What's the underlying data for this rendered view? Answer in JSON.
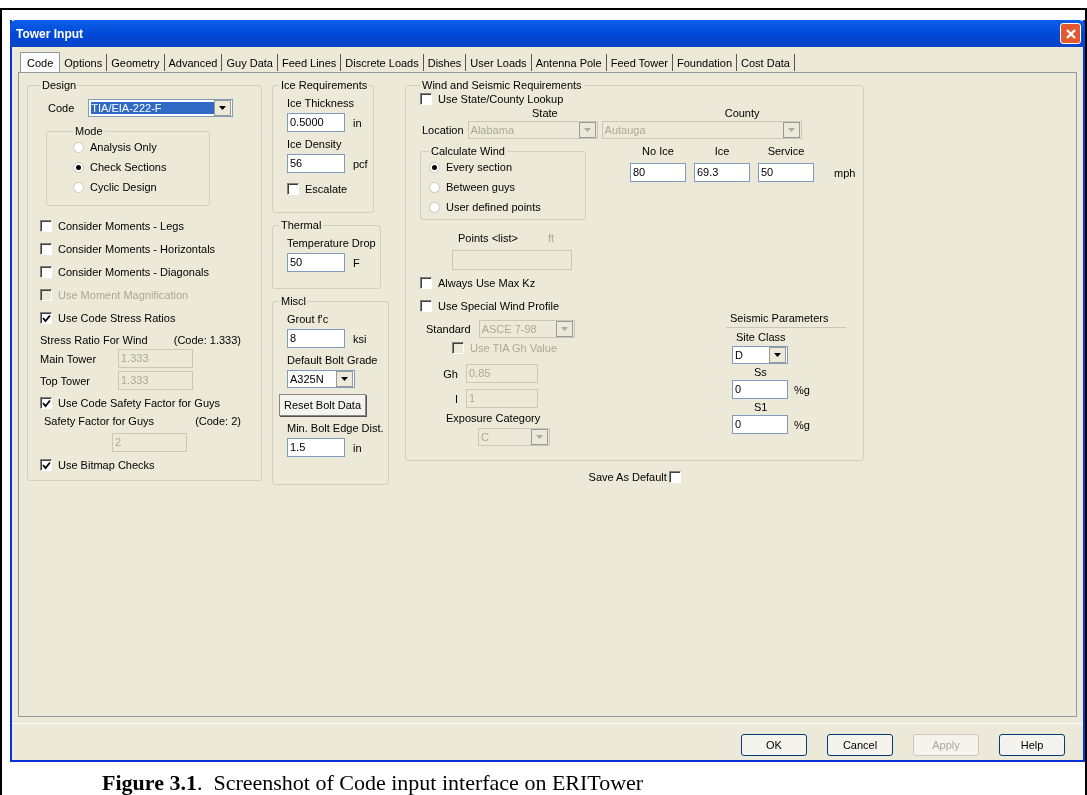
{
  "window": {
    "title": "Tower Input"
  },
  "tabs": [
    {
      "label": "Code",
      "selected": true
    },
    {
      "label": "Options",
      "selected": false
    },
    {
      "label": "Geometry",
      "selected": false
    },
    {
      "label": "Advanced",
      "selected": false
    },
    {
      "label": "Guy Data",
      "selected": false
    },
    {
      "label": "Feed Lines",
      "selected": false
    },
    {
      "label": "Discrete Loads",
      "selected": false
    },
    {
      "label": "Dishes",
      "selected": false
    },
    {
      "label": "User Loads",
      "selected": false
    },
    {
      "label": "Antenna Pole",
      "selected": false
    },
    {
      "label": "Feed Tower",
      "selected": false
    },
    {
      "label": "Foundation",
      "selected": false
    },
    {
      "label": "Cost Data",
      "selected": false
    }
  ],
  "design": {
    "title": "Design",
    "code_label": "Code",
    "code_value": "TIA/EIA-222-F",
    "mode": {
      "title": "Mode",
      "options": [
        {
          "label": "Analysis Only",
          "selected": false
        },
        {
          "label": "Check Sections",
          "selected": true
        },
        {
          "label": "Cyclic Design",
          "selected": false
        }
      ]
    },
    "checks": [
      {
        "label": "Consider Moments - Legs",
        "checked": false,
        "disabled": false
      },
      {
        "label": "Consider Moments - Horizontals",
        "checked": false,
        "disabled": false
      },
      {
        "label": "Consider Moments - Diagonals",
        "checked": false,
        "disabled": false
      },
      {
        "label": "Use Moment Magnification",
        "checked": false,
        "disabled": true
      },
      {
        "label": "Use Code Stress Ratios",
        "checked": true,
        "disabled": false
      }
    ],
    "stress_ratio": {
      "label": "Stress Ratio For Wind",
      "code_note": "(Code: 1.333)",
      "fields": [
        {
          "label": "Main Tower",
          "value": "1.333",
          "disabled": true
        },
        {
          "label": "Top Tower",
          "value": "1.333",
          "disabled": true
        }
      ]
    },
    "safety": {
      "check": {
        "label": "Use Code Safety Factor for Guys",
        "checked": true
      },
      "label": "Safety Factor for Guys",
      "code_note": "(Code: 2)",
      "value": "2",
      "disabled": true
    },
    "bitmap": {
      "label": "Use Bitmap Checks",
      "checked": true
    }
  },
  "ice": {
    "title": "Ice Requirements",
    "fields": [
      {
        "label": "Ice Thickness",
        "value": "0.5000",
        "unit": "in"
      },
      {
        "label": "Ice Density",
        "value": "56",
        "unit": "pcf"
      }
    ],
    "escalate": {
      "label": "Escalate",
      "checked": false
    }
  },
  "thermal": {
    "title": "Thermal",
    "label": "Temperature Drop",
    "value": "50",
    "unit": "F"
  },
  "miscl": {
    "title": "Miscl",
    "grout": {
      "label": "Grout f'c",
      "value": "8",
      "unit": "ksi"
    },
    "bolt_grade": {
      "label": "Default Bolt Grade",
      "value": "A325N"
    },
    "reset_button": "Reset Bolt Data",
    "edge": {
      "label": "Min. Bolt Edge Dist.",
      "value": "1.5",
      "unit": "in"
    }
  },
  "wind": {
    "title": "Wind and Seismic Requirements",
    "lookup": {
      "label": "Use State/County Lookup",
      "checked": false
    },
    "state_header": "State",
    "county_header": "County",
    "location_label": "Location",
    "state": {
      "value": "Alabama",
      "disabled": true
    },
    "county": {
      "value": "Autauga",
      "disabled": true
    },
    "calc": {
      "title": "Calculate Wind",
      "options": [
        {
          "label": "Every section",
          "selected": true
        },
        {
          "label": "Between guys",
          "selected": false
        },
        {
          "label": "User defined points",
          "selected": false
        }
      ]
    },
    "speeds": {
      "headers": [
        "No Ice",
        "Ice",
        "Service"
      ],
      "values": [
        "80",
        "69.3",
        "50"
      ],
      "unit": "mph"
    },
    "points": {
      "label": "Points <list>",
      "unit": "ft",
      "disabled": true
    },
    "max_kz": {
      "label": "Always Use Max Kz",
      "checked": false
    },
    "special": {
      "label": "Use Special Wind Profile",
      "checked": false
    },
    "standard": {
      "label": "Standard",
      "value": "ASCE 7-98",
      "disabled": true
    },
    "tia_gh": {
      "label": "Use TIA Gh Value",
      "checked": false,
      "disabled": true
    },
    "gh": {
      "label": "Gh",
      "value": "0.85",
      "disabled": true
    },
    "i": {
      "label": "I",
      "value": "1",
      "disabled": true
    },
    "exposure": {
      "label": "Exposure Category",
      "value": "C",
      "disabled": true
    },
    "seismic": {
      "title": "Seismic Parameters",
      "site_class": {
        "label": "Site Class",
        "value": "D"
      },
      "ss": {
        "label": "Ss",
        "value": "0",
        "unit": "%g"
      },
      "s1": {
        "label": "S1",
        "value": "0",
        "unit": "%g"
      }
    }
  },
  "save_default": {
    "label": "Save As Default",
    "checked": false
  },
  "buttons": [
    {
      "label": "OK",
      "disabled": false
    },
    {
      "label": "Cancel",
      "disabled": false
    },
    {
      "label": "Apply",
      "disabled": true
    },
    {
      "label": "Help",
      "disabled": false
    }
  ],
  "caption": "**Figure 3.1**.  Screenshot of Code input interface on ERITower"
}
